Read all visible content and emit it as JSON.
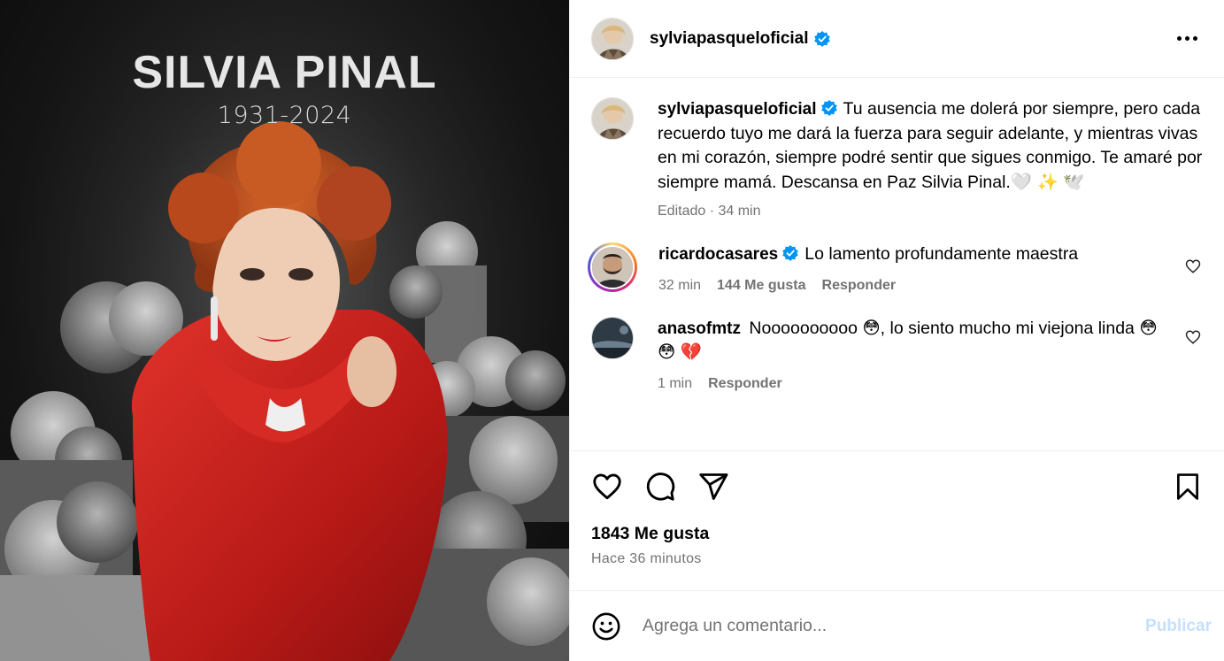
{
  "media": {
    "title": "SILVIA PINAL",
    "years": "1931-2024"
  },
  "header": {
    "username": "sylviapasqueloficial",
    "verified": true,
    "more_icon": "more-horizontal-icon"
  },
  "caption": {
    "username": "sylviapasqueloficial",
    "text": "Tu ausencia me dolerá por siempre, pero cada recuerdo tuyo me dará la fuerza para seguir adelante, y mientras vivas en mi corazón, siempre podré sentir que sigues conmigo. Te amaré por siempre mamá. Descansa en Paz Silvia Pinal.🤍 ✨ 🕊️",
    "meta": "Editado · 34 min"
  },
  "comments": [
    {
      "username": "ricardocasares",
      "verified": true,
      "text": "Lo lamento profundamente maestra",
      "time": "32 min",
      "likes": "144 Me gusta",
      "reply": "Responder"
    },
    {
      "username": "anasofmtz",
      "verified": false,
      "text": "Noooooooooo 😳, lo siento mucho mi viejona linda 😳 😳 💔",
      "time": "1 min",
      "reply": "Responder"
    }
  ],
  "actions": {
    "like_icon": "heart-icon",
    "comment_icon": "comment-icon",
    "share_icon": "send-icon",
    "save_icon": "bookmark-icon"
  },
  "likes": {
    "count": "1843 Me gusta",
    "time": "Hace 36 minutos"
  },
  "add_comment": {
    "placeholder": "Agrega un comentario...",
    "publish": "Publicar"
  },
  "colors": {
    "verified_blue": "#0095f6",
    "muted_text": "#737373",
    "publish_disabled": "#c5e0fd",
    "dress_red": "#c8201c",
    "hair_auburn": "#b24a1e"
  }
}
